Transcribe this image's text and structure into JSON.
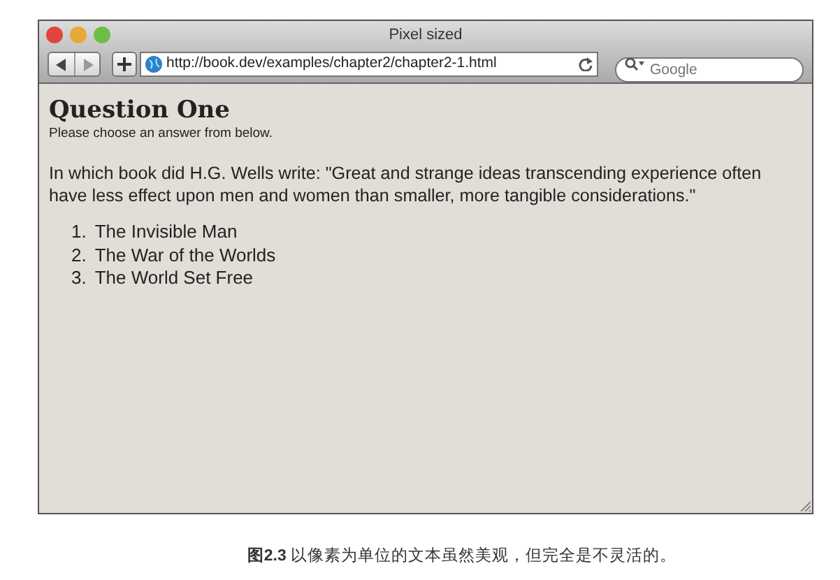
{
  "window": {
    "title": "Pixel sized"
  },
  "toolbar": {
    "url": "http://book.dev/examples/chapter2/chapter2-1.html",
    "search_placeholder": "Google"
  },
  "page": {
    "heading": "Question One",
    "subheading": "Please choose an answer from below.",
    "question": "In which book did H.G. Wells write: \"Great and strange ideas transcending experience often have less effect upon men and women than smaller, more tangible considerations.\"",
    "answers": [
      {
        "number": "1.",
        "text": "The Invisible Man"
      },
      {
        "number": "2.",
        "text": "The War of the Worlds"
      },
      {
        "number": "3.",
        "text": "The World Set Free"
      }
    ]
  },
  "caption": "**图2.3** 以像素为单位的文本虽然美观，但完全是不灵活的。"
}
